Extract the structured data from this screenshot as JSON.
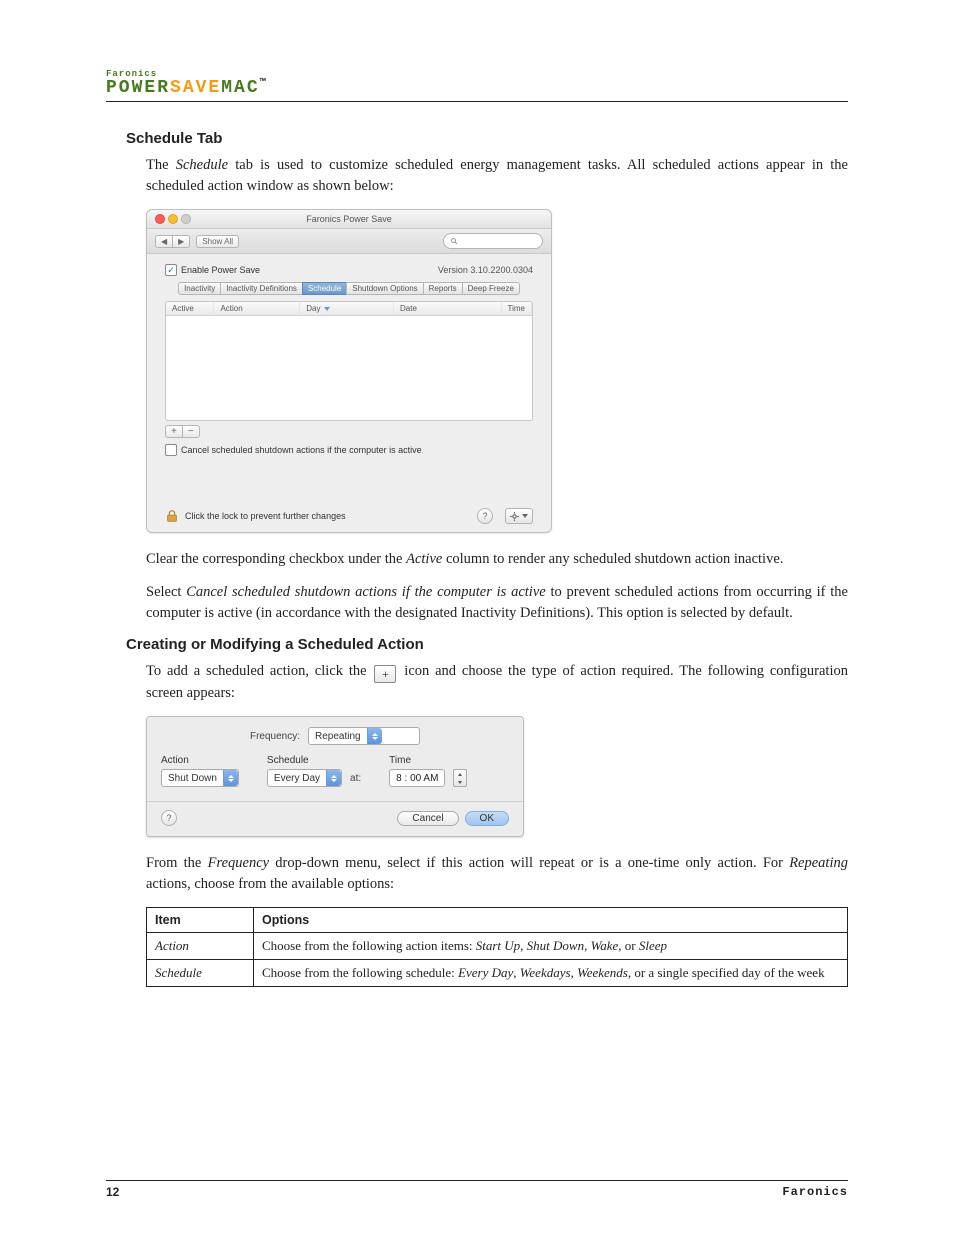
{
  "brand": {
    "small": "Faronics",
    "p1": "POWER",
    "p2": "SAVE",
    "p3": "MAC",
    "tm": "™"
  },
  "section1_title": "Schedule Tab",
  "section1_para": "The Schedule tab is used to customize scheduled energy management tasks. All scheduled actions appear in the scheduled action window as shown below:",
  "pref": {
    "title": "Faronics Power Save",
    "back": "◀",
    "fwd": "▶",
    "showall": "Show All",
    "enable": "Enable Power Save",
    "version": "Version 3.10.2200.0304",
    "tabs": [
      "Inactivity",
      "Inactivity Definitions",
      "Schedule",
      "Shutdown Options",
      "Reports",
      "Deep Freeze"
    ],
    "tab_active_index": 2,
    "cols": {
      "active": "Active",
      "action": "Action",
      "day": "Day",
      "date": "Date",
      "time": "Time"
    },
    "plus": "+",
    "minus": "−",
    "cancel_chk": "Cancel scheduled shutdown actions if the computer is active",
    "lock_text": "Click the lock to prevent further changes",
    "help": "?"
  },
  "para_clear": "Clear the corresponding checkbox under the Active column to render any scheduled shutdown action inactive.",
  "para_cancel": "Select Cancel scheduled shutdown actions if the computer is active to prevent scheduled actions from occurring if the computer is active (in accordance with the designated Inactivity Definitions). This option is selected by default.",
  "section2_title": "Creating or Modifying a Scheduled Action",
  "para_add_a": "To add a scheduled action, click the ",
  "para_add_b": " icon and choose the type of action required. The following configuration screen appears:",
  "plus_icon": "+",
  "dialog": {
    "freq_label": "Frequency:",
    "freq_value": "Repeating",
    "hdr_action": "Action",
    "hdr_schedule": "Schedule",
    "hdr_time": "Time",
    "action_value": "Shut Down",
    "schedule_value": "Every Day",
    "at_label": "at:",
    "time_value": "8 : 00 AM",
    "help": "?",
    "cancel": "Cancel",
    "ok": "OK"
  },
  "para_freq": "From the Frequency drop-down menu, select if this action will repeat or is a one-time only action. For Repeating actions, choose from the available options:",
  "table": {
    "h1": "Item",
    "h2": "Options",
    "r1c1": "Action",
    "r1c2": "Choose from the following action items: Start Up, Shut Down, Wake, or Sleep",
    "r2c1": "Schedule",
    "r2c2": "Choose from the following schedule: Every Day, Weekdays, Weekends, or a single specified day of the week"
  },
  "footer": {
    "page": "12",
    "company": "Faronics"
  }
}
